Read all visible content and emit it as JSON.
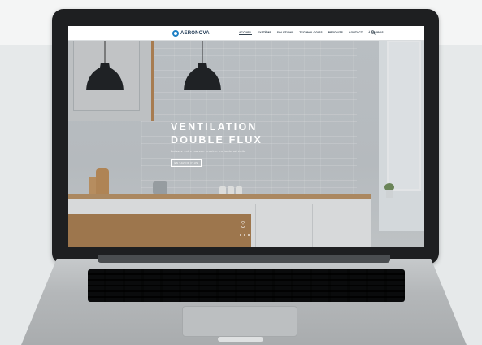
{
  "site": {
    "logo_text": "AERONOVA",
    "nav": [
      {
        "label": "ACCUEIL",
        "active": true
      },
      {
        "label": "SYSTÈME",
        "active": false
      },
      {
        "label": "SOLUTIONS",
        "active": false
      },
      {
        "label": "TECHNOLOGIES",
        "active": false
      },
      {
        "label": "PRODUITS",
        "active": false
      },
      {
        "label": "CONTACT",
        "active": false
      },
      {
        "label": "À PROPOS",
        "active": false
      }
    ],
    "search_icon": "search-icon"
  },
  "hero": {
    "title_line1": "VENTILATION",
    "title_line2": "DOUBLE FLUX",
    "subtitle": "Laissez votre maison respirer en toute sérénité",
    "button_label": "EN SAVOIR PLUS",
    "slide_count": 3
  },
  "colors": {
    "accent": "#1d7fc4",
    "header_bg": "#ffffff",
    "laptop_bezel": "#1e1f21"
  }
}
